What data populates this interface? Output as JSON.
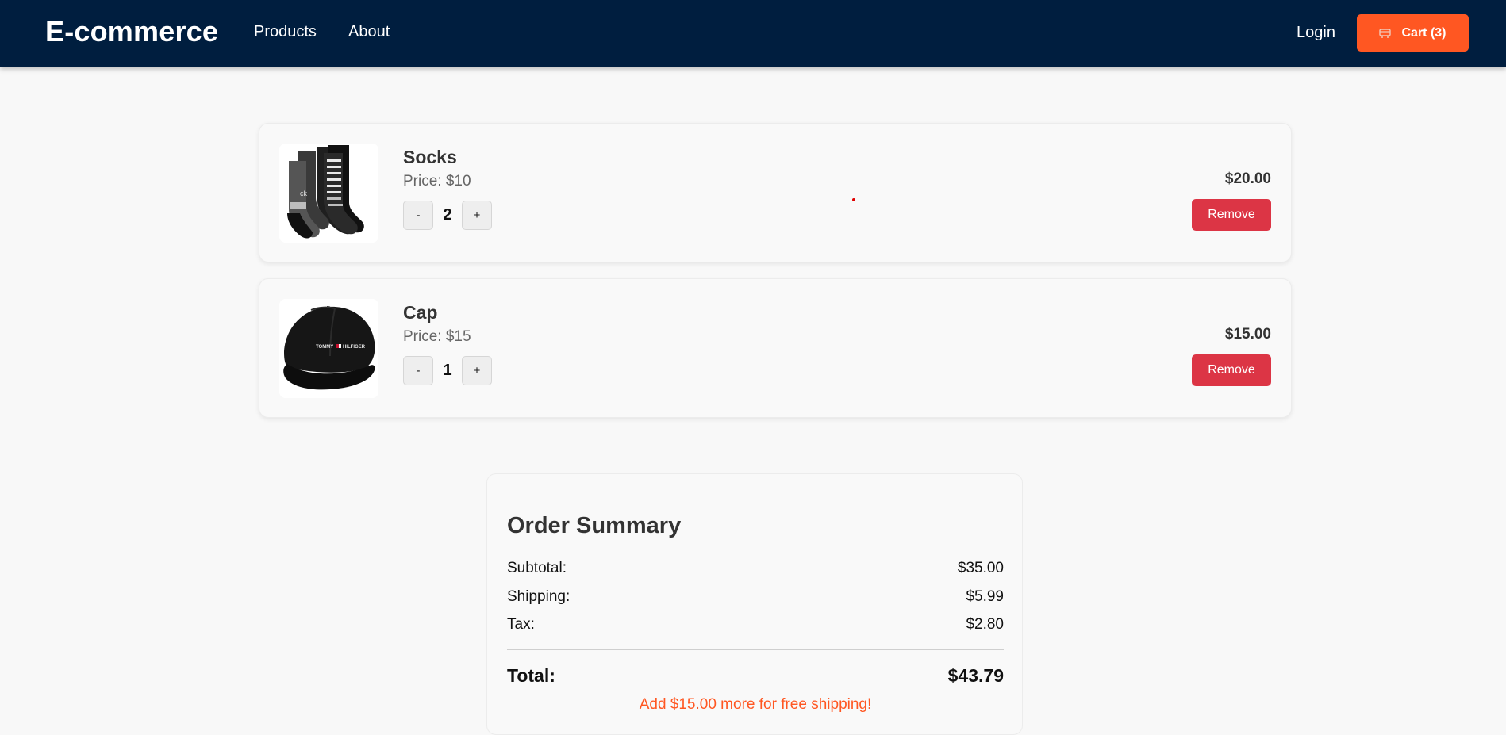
{
  "navbar": {
    "brand": "E-commerce",
    "links": {
      "products": "Products",
      "about": "About",
      "login": "Login"
    },
    "cart_button": {
      "icon": "cart-icon",
      "label": "Cart (3)"
    }
  },
  "cart": {
    "items": [
      {
        "name": "Socks",
        "price": "Price: $10",
        "quantity": "2",
        "minus_label": "-",
        "plus_label": "+",
        "total": "$20.00",
        "remove_label": "Remove",
        "image": "socks-product-image"
      },
      {
        "name": "Cap",
        "price": "Price: $15",
        "quantity": "1",
        "minus_label": "-",
        "plus_label": "+",
        "total": "$15.00",
        "remove_label": "Remove",
        "image": "cap-product-image"
      }
    ]
  },
  "summary": {
    "title": "Order Summary",
    "subtotal_label": "Subtotal:",
    "subtotal_value": "$35.00",
    "shipping_label": "Shipping:",
    "shipping_value": "$5.99",
    "tax_label": "Tax:",
    "tax_value": "$2.80",
    "total_label": "Total:",
    "total_value": "$43.79",
    "free_shipping_note": "Add $15.00 more for free shipping!"
  },
  "colors": {
    "navbar_bg": "#001e3f",
    "accent": "#ff5722",
    "danger": "#dc3545",
    "page_bg": "#f8f8f8"
  }
}
